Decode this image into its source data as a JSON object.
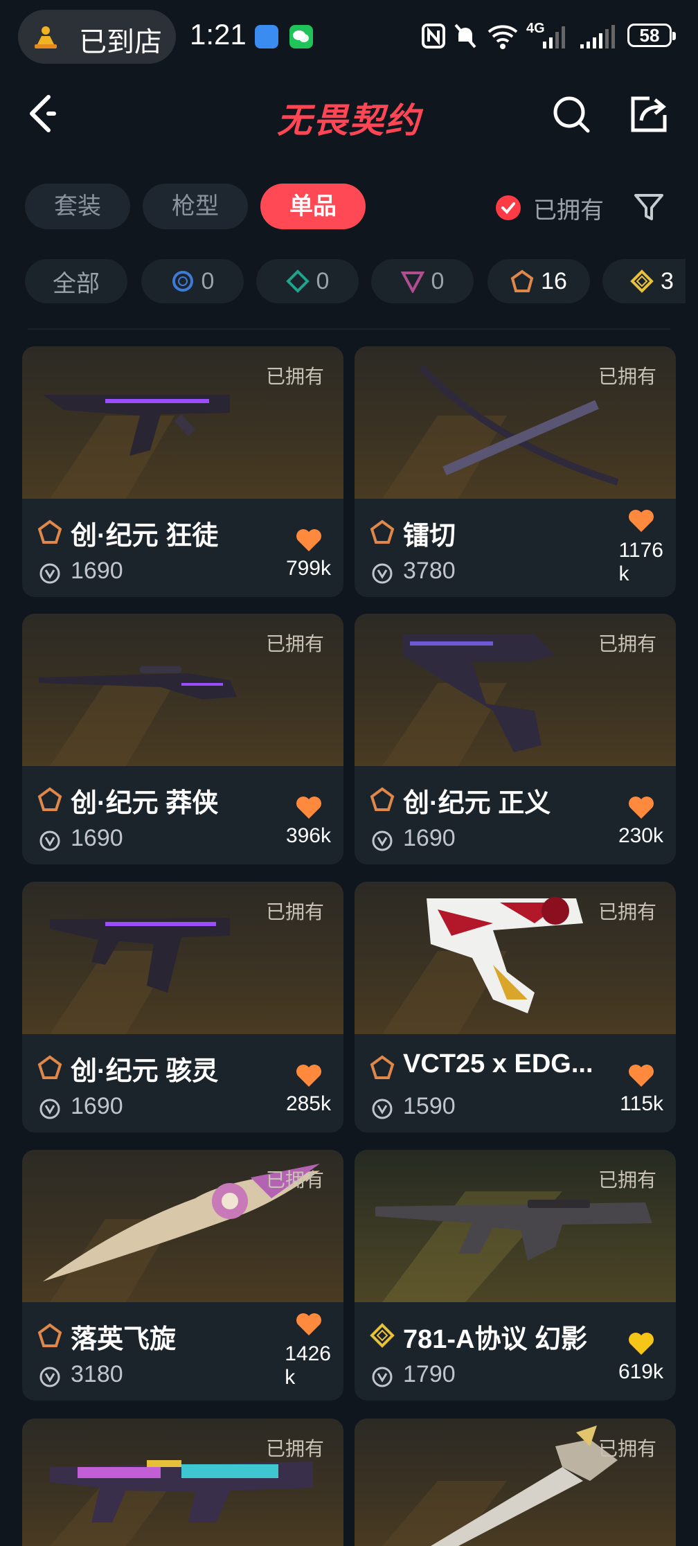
{
  "status_bar": {
    "app_pill": "已到店",
    "time": "1:21",
    "network": "4G",
    "battery": "58"
  },
  "header": {
    "title": "无畏契约"
  },
  "tabs": [
    {
      "label": "套装",
      "active": false
    },
    {
      "label": "枪型",
      "active": false
    },
    {
      "label": "单品",
      "active": true
    }
  ],
  "owned_filter": {
    "label": "已拥有",
    "checked": true
  },
  "rarity_filters": [
    {
      "label": "全部"
    },
    {
      "count": "0",
      "tier": "blue"
    },
    {
      "count": "0",
      "tier": "green"
    },
    {
      "count": "0",
      "tier": "purple"
    },
    {
      "count": "16",
      "tier": "orange"
    },
    {
      "count": "3",
      "tier": "gold"
    }
  ],
  "colors": {
    "accent": "#ff4a55",
    "like_orange": "#ff8a3d",
    "like_gold": "#f5c518",
    "tier_orange": "#e0874a",
    "tier_gold": "#e9c23b"
  },
  "skins": [
    {
      "name": "创·纪元 狂徒",
      "price": "1690",
      "likes": "799k",
      "owned": "已拥有",
      "tier": "orange"
    },
    {
      "name": "镭切",
      "price": "3780",
      "likes": "1176\nk",
      "owned": "已拥有",
      "tier": "orange"
    },
    {
      "name": "创·纪元 莽侠",
      "price": "1690",
      "likes": "396k",
      "owned": "已拥有",
      "tier": "orange"
    },
    {
      "name": "创·纪元 正义",
      "price": "1690",
      "likes": "230k",
      "owned": "已拥有",
      "tier": "orange"
    },
    {
      "name": "创·纪元 骇灵",
      "price": "1690",
      "likes": "285k",
      "owned": "已拥有",
      "tier": "orange"
    },
    {
      "name": "VCT25 x EDG...",
      "price": "1590",
      "likes": "115k",
      "owned": "已拥有",
      "tier": "orange"
    },
    {
      "name": "落英飞旋",
      "price": "3180",
      "likes": "1426\nk",
      "owned": "已拥有",
      "tier": "orange"
    },
    {
      "name": "781-A协议 幻影",
      "price": "1790",
      "likes": "619k",
      "owned": "已拥有",
      "tier": "gold"
    },
    {
      "name": "",
      "price": "",
      "likes": "",
      "owned": "已拥有",
      "tier": "orange"
    },
    {
      "name": "",
      "price": "",
      "likes": "",
      "owned": "已拥有",
      "tier": "orange"
    }
  ]
}
